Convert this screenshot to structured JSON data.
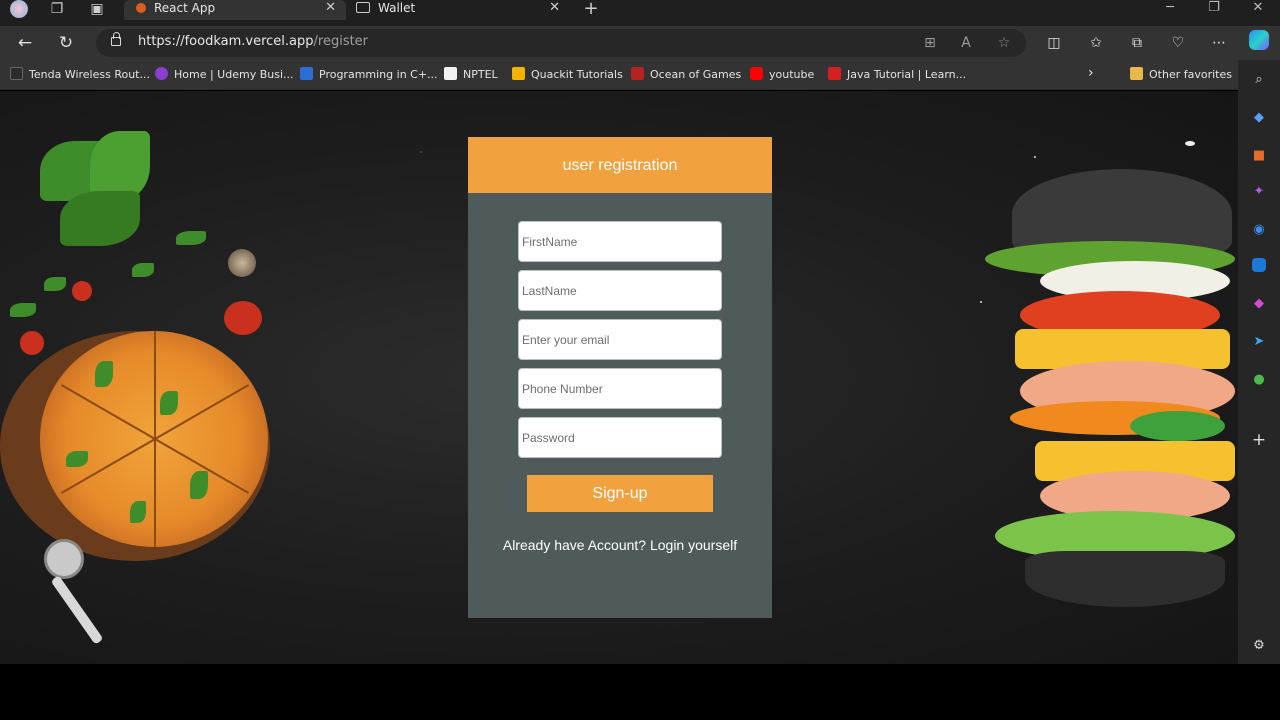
{
  "browser": {
    "tabs": [
      {
        "label": "React App",
        "active": true
      },
      {
        "label": "Wallet",
        "active": false
      }
    ],
    "url_host": "https://foodkam.vercel.app",
    "url_path": "/register",
    "favorites": [
      {
        "label": "Tenda Wireless Rout...",
        "color": "#2b2b2b"
      },
      {
        "label": "Home | Udemy Busi...",
        "color": "#8b3fd1"
      },
      {
        "label": "Programming in C+...",
        "color": "#2b6fd1"
      },
      {
        "label": "NPTEL",
        "color": "#ffffff"
      },
      {
        "label": "Quackit Tutorials",
        "color": "#f2b400"
      },
      {
        "label": "Ocean of Games",
        "color": "#b52222"
      },
      {
        "label": "youtube",
        "color": "#ff0000"
      },
      {
        "label": "Java Tutorial | Learn...",
        "color": "#d42020"
      }
    ],
    "other_favorites": "Other favorites"
  },
  "form": {
    "title": "user registration",
    "firstname_placeholder": "FirstName",
    "lastname_placeholder": "LastName",
    "email_placeholder": "Enter your email",
    "phone_placeholder": "Phone Number",
    "password_placeholder": "Password",
    "signup_label": "Sign-up",
    "login_text": "Already have Account? Login yourself"
  },
  "colors": {
    "accent": "#f1a23f",
    "card": "#4f5a5a"
  }
}
